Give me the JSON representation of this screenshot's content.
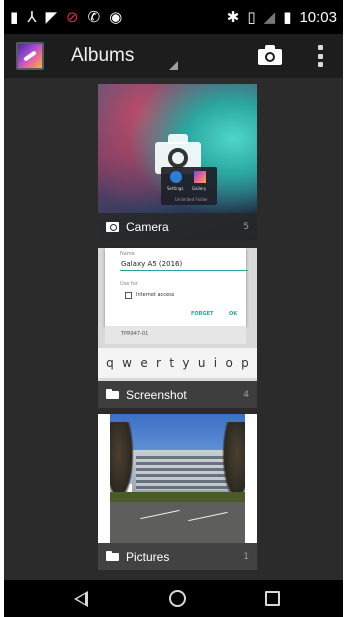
{
  "status_bar": {
    "time": "10:03",
    "left_icons": [
      "sim-icon",
      "network-icon",
      "sd-card-icon",
      "no-sim-icon",
      "call-icon",
      "android-icon"
    ],
    "right_icons": [
      "bluetooth-icon",
      "vibrate-icon",
      "no-signal-icon",
      "battery-icon"
    ]
  },
  "action_bar": {
    "title": "Albums",
    "accent_color": "#1d1d1d"
  },
  "albums": [
    {
      "name": "Camera",
      "count": "5",
      "icon": "camera-icon",
      "thumb": {
        "popup_item_1": "Settings",
        "popup_item_2": "Gallery",
        "popup_footer": "Unlimited Folder"
      }
    },
    {
      "name": "Screenshot",
      "count": "4",
      "icon": "folder-icon",
      "thumb": {
        "field_label": "Name",
        "field_value": "Galaxy A5 (2016)",
        "use_for_label": "Use for",
        "checkbox_label": "Internet access",
        "forget_label": "FORGET",
        "ok_label": "OK",
        "row_text": "TPR947-01",
        "keys": [
          "q",
          "w",
          "e",
          "r",
          "t",
          "y",
          "u",
          "i",
          "o",
          "p"
        ]
      }
    },
    {
      "name": "Pictures",
      "count": "1",
      "icon": "folder-icon"
    }
  ],
  "nav_bar": {
    "buttons": [
      "back-icon",
      "home-icon",
      "recents-icon"
    ]
  }
}
